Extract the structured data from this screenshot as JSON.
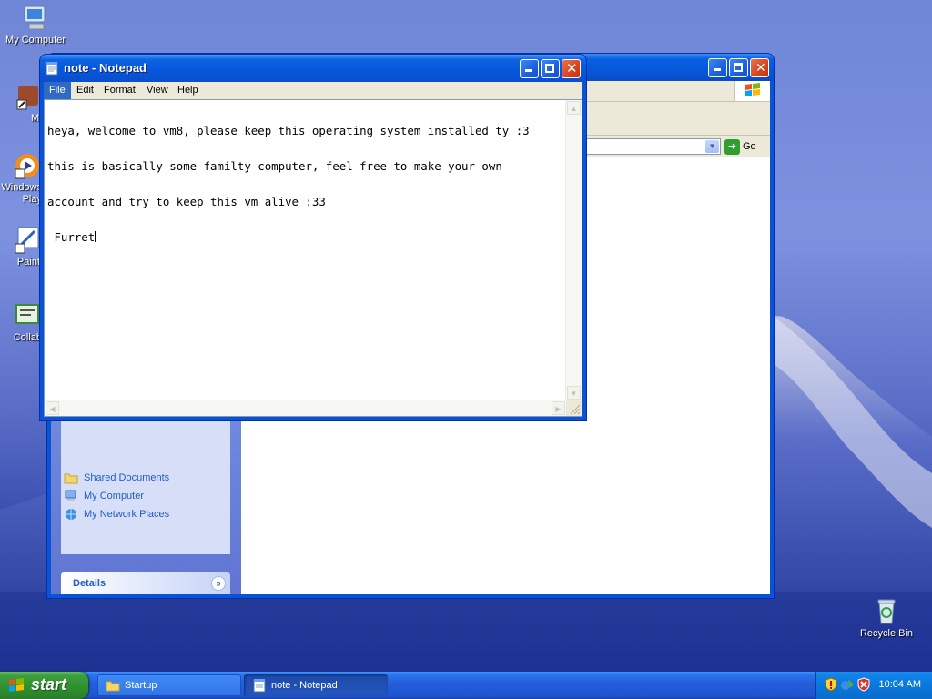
{
  "desktop": {
    "icons": [
      {
        "label": "My Computer",
        "icon": "my-computer-icon"
      },
      {
        "label": "MyP",
        "icon": "shortcut-icon"
      },
      {
        "label": "Windows Play",
        "icon": "windows-media-player-icon"
      },
      {
        "label": "Paint",
        "icon": "paint-icon"
      },
      {
        "label": "Collab",
        "icon": "collab-icon"
      },
      {
        "label": "Recycle Bin",
        "icon": "recycle-bin-icon"
      }
    ]
  },
  "explorer": {
    "address": {
      "value": "",
      "go_label": "Go"
    },
    "task_pane": {
      "links": [
        {
          "label": "Shared Documents",
          "icon": "folder-icon"
        },
        {
          "label": "My Computer",
          "icon": "my-computer-icon"
        },
        {
          "label": "My Network Places",
          "icon": "network-places-icon"
        }
      ],
      "details_header": "Details"
    }
  },
  "notepad": {
    "title": "note - Notepad",
    "menu": [
      "File",
      "Edit",
      "Format",
      "View",
      "Help"
    ],
    "active_menu": "File",
    "content": {
      "line1": "heya, welcome to vm8, please keep this operating system installed ty :3",
      "line2": "this is basically some familty computer, feel free to make your own",
      "line3": "account and try to keep this vm alive :33",
      "line4": "-Furret"
    }
  },
  "taskbar": {
    "start_label": "start",
    "tasks": [
      {
        "label": "Startup",
        "icon": "folder-icon",
        "active": false
      },
      {
        "label": "note - Notepad",
        "icon": "notepad-icon",
        "active": true
      }
    ],
    "clock": "10:04 AM",
    "tray_icons": [
      "security-shield-icon",
      "network-icon",
      "security-alert-icon"
    ]
  },
  "colors": {
    "xp_blue": "#0a52d6",
    "start_green": "#3c9e3c",
    "menu_highlight": "#316ac5"
  }
}
